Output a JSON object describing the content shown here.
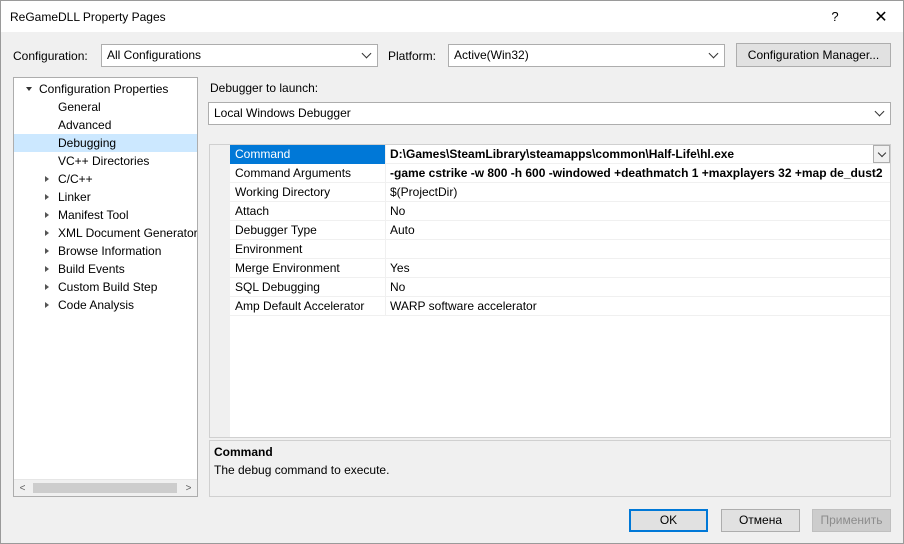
{
  "window": {
    "title": "ReGameDLL Property Pages",
    "help_glyph": "?",
    "close_glyph": "✕"
  },
  "config_bar": {
    "configuration_label": "Configuration:",
    "configuration_value": "All Configurations",
    "platform_label": "Platform:",
    "platform_value": "Active(Win32)",
    "manager_button": "Configuration Manager..."
  },
  "tree": {
    "items": [
      {
        "label": "Configuration Properties",
        "level": 0,
        "toggle": "expanded"
      },
      {
        "label": "General",
        "level": 1,
        "toggle": "none"
      },
      {
        "label": "Advanced",
        "level": 1,
        "toggle": "none"
      },
      {
        "label": "Debugging",
        "level": 1,
        "toggle": "none",
        "selected": true
      },
      {
        "label": "VC++ Directories",
        "level": 1,
        "toggle": "none"
      },
      {
        "label": "C/C++",
        "level": 1,
        "toggle": "collapsed"
      },
      {
        "label": "Linker",
        "level": 1,
        "toggle": "collapsed"
      },
      {
        "label": "Manifest Tool",
        "level": 1,
        "toggle": "collapsed"
      },
      {
        "label": "XML Document Generator",
        "level": 1,
        "toggle": "collapsed"
      },
      {
        "label": "Browse Information",
        "level": 1,
        "toggle": "collapsed"
      },
      {
        "label": "Build Events",
        "level": 1,
        "toggle": "collapsed"
      },
      {
        "label": "Custom Build Step",
        "level": 1,
        "toggle": "collapsed"
      },
      {
        "label": "Code Analysis",
        "level": 1,
        "toggle": "collapsed"
      }
    ]
  },
  "debugger": {
    "label": "Debugger to launch:",
    "value": "Local Windows Debugger"
  },
  "properties": [
    {
      "name": "Command",
      "value": "D:\\Games\\SteamLibrary\\steamapps\\common\\Half-Life\\hl.exe",
      "bold": true,
      "selected": true,
      "dropdown": true
    },
    {
      "name": "Command Arguments",
      "value": "-game cstrike -w 800 -h 600 -windowed +deathmatch 1 +maxplayers 32 +map de_dust2",
      "bold": true
    },
    {
      "name": "Working Directory",
      "value": "$(ProjectDir)"
    },
    {
      "name": "Attach",
      "value": "No"
    },
    {
      "name": "Debugger Type",
      "value": "Auto"
    },
    {
      "name": "Environment",
      "value": ""
    },
    {
      "name": "Merge Environment",
      "value": "Yes"
    },
    {
      "name": "SQL Debugging",
      "value": "No"
    },
    {
      "name": "Amp Default Accelerator",
      "value": "WARP software accelerator"
    }
  ],
  "description": {
    "title": "Command",
    "text": "The debug command to execute."
  },
  "buttons": {
    "ok": "OK",
    "cancel": "Отмена",
    "apply": "Применить"
  },
  "colors": {
    "selection": "#0078d7",
    "tree_selection": "#cce8ff"
  }
}
